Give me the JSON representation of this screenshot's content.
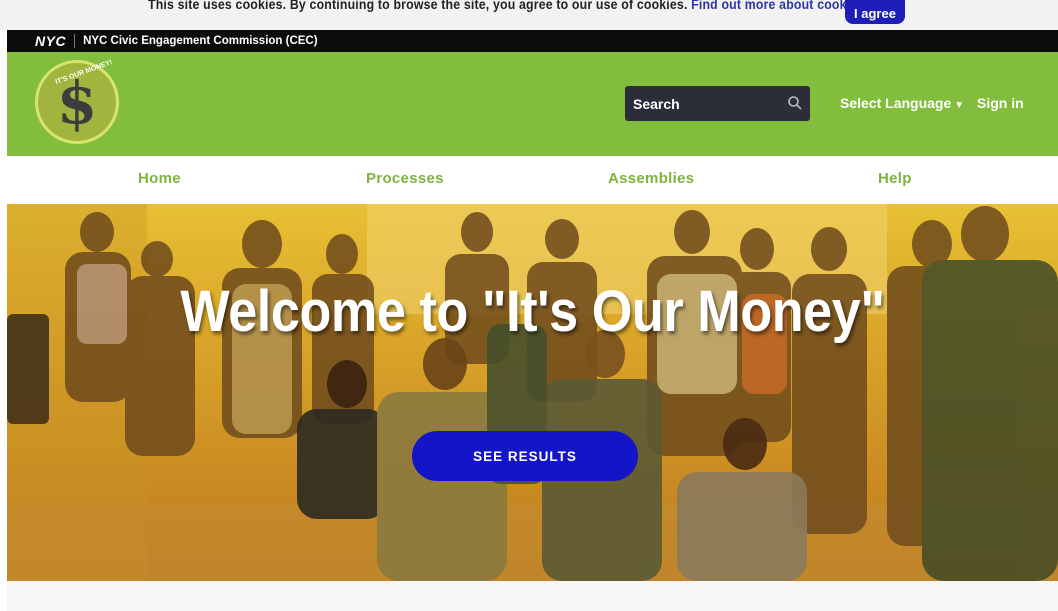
{
  "cookie": {
    "text": "This site uses cookies. By continuing to browse the site, you agree to our use of cookies. ",
    "link": "Find out more about cookies",
    "agree_label": "I agree"
  },
  "top_bar": {
    "logo": "NYC",
    "agency": "NYC Civic Engagement Commission (CEC)"
  },
  "header": {
    "logo_ring_text": "IT'S OUR MONEY!",
    "logo_symbol": "$",
    "search_placeholder": "Search",
    "language_label": "Select Language",
    "language_caret": "▼",
    "signin_label": "Sign in",
    "brand_color": "#82bd3d"
  },
  "nav": {
    "items": [
      {
        "label": "Home"
      },
      {
        "label": "Processes"
      },
      {
        "label": "Assemblies"
      },
      {
        "label": "Help"
      }
    ]
  },
  "hero": {
    "title": "Welcome to \"It's Our Money\"",
    "button_label": "SEE RESULTS",
    "button_color": "#1414c8"
  }
}
